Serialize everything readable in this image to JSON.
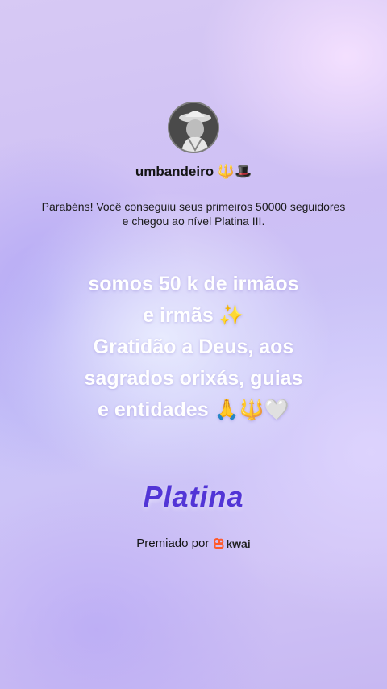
{
  "profile": {
    "username": "umbandeiro 🔱🎩",
    "avatar_icon": "masked-figure-avatar"
  },
  "congrats_text": "Parabéns! Você conseguiu seus primeiros 50000 seguidores e chegou ao nível Platina III.",
  "message_lines": [
    "somos 50 k de irmãos",
    "e irmãs ✨",
    "Gratidão a Deus, aos",
    "sagrados orixás, guias",
    "e entidades 🙏🔱🤍"
  ],
  "level_title": "Platina",
  "awarded_by": {
    "label": "Premiado por",
    "brand": "kwai",
    "brand_color": "#ff5a2b"
  }
}
